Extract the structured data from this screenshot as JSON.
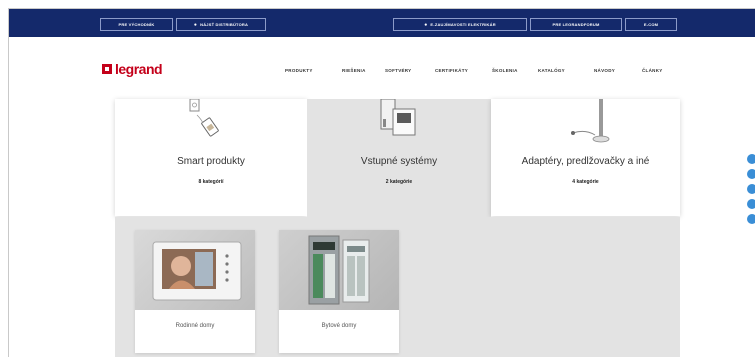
{
  "topbar": {
    "links": [
      {
        "label": "PRE VÝCHODNÍK",
        "icon": ""
      },
      {
        "label": "NÁJSŤ DISTRIBÚTORA",
        "icon": "location-pin-icon"
      },
      {
        "label": "E-ZAUJÍMAVOSTI ELEKTRIKÁR",
        "icon": "user-icon"
      },
      {
        "label": "PRE LEGRANDFORUM",
        "icon": ""
      },
      {
        "label": "E-COM",
        "icon": ""
      }
    ]
  },
  "header": {
    "logo_text": "legrand",
    "nav": [
      "PRODUKTY",
      "RIEŠENIA",
      "SOFTVÉRY",
      "CERTIFIKÁTY",
      "ŠKOLENIA",
      "KATALÓGY",
      "NÁVODY",
      "ČLÁNKY"
    ]
  },
  "categories": [
    {
      "title": "Smart produkty",
      "count": "8 kategórií"
    },
    {
      "title": "Vstupné systémy",
      "count": "2 kategórie"
    },
    {
      "title": "Adaptéry, predlžovačky a iné",
      "count": "4 kategórie"
    }
  ],
  "subcategories": [
    {
      "label": "Rodinné domy"
    },
    {
      "label": "Bytové domy"
    }
  ],
  "colors": {
    "topbar": "#14296b",
    "brand_red": "#c4001a",
    "panel_bg": "#e3e3e3",
    "side_dot": "#3a8ed6"
  }
}
